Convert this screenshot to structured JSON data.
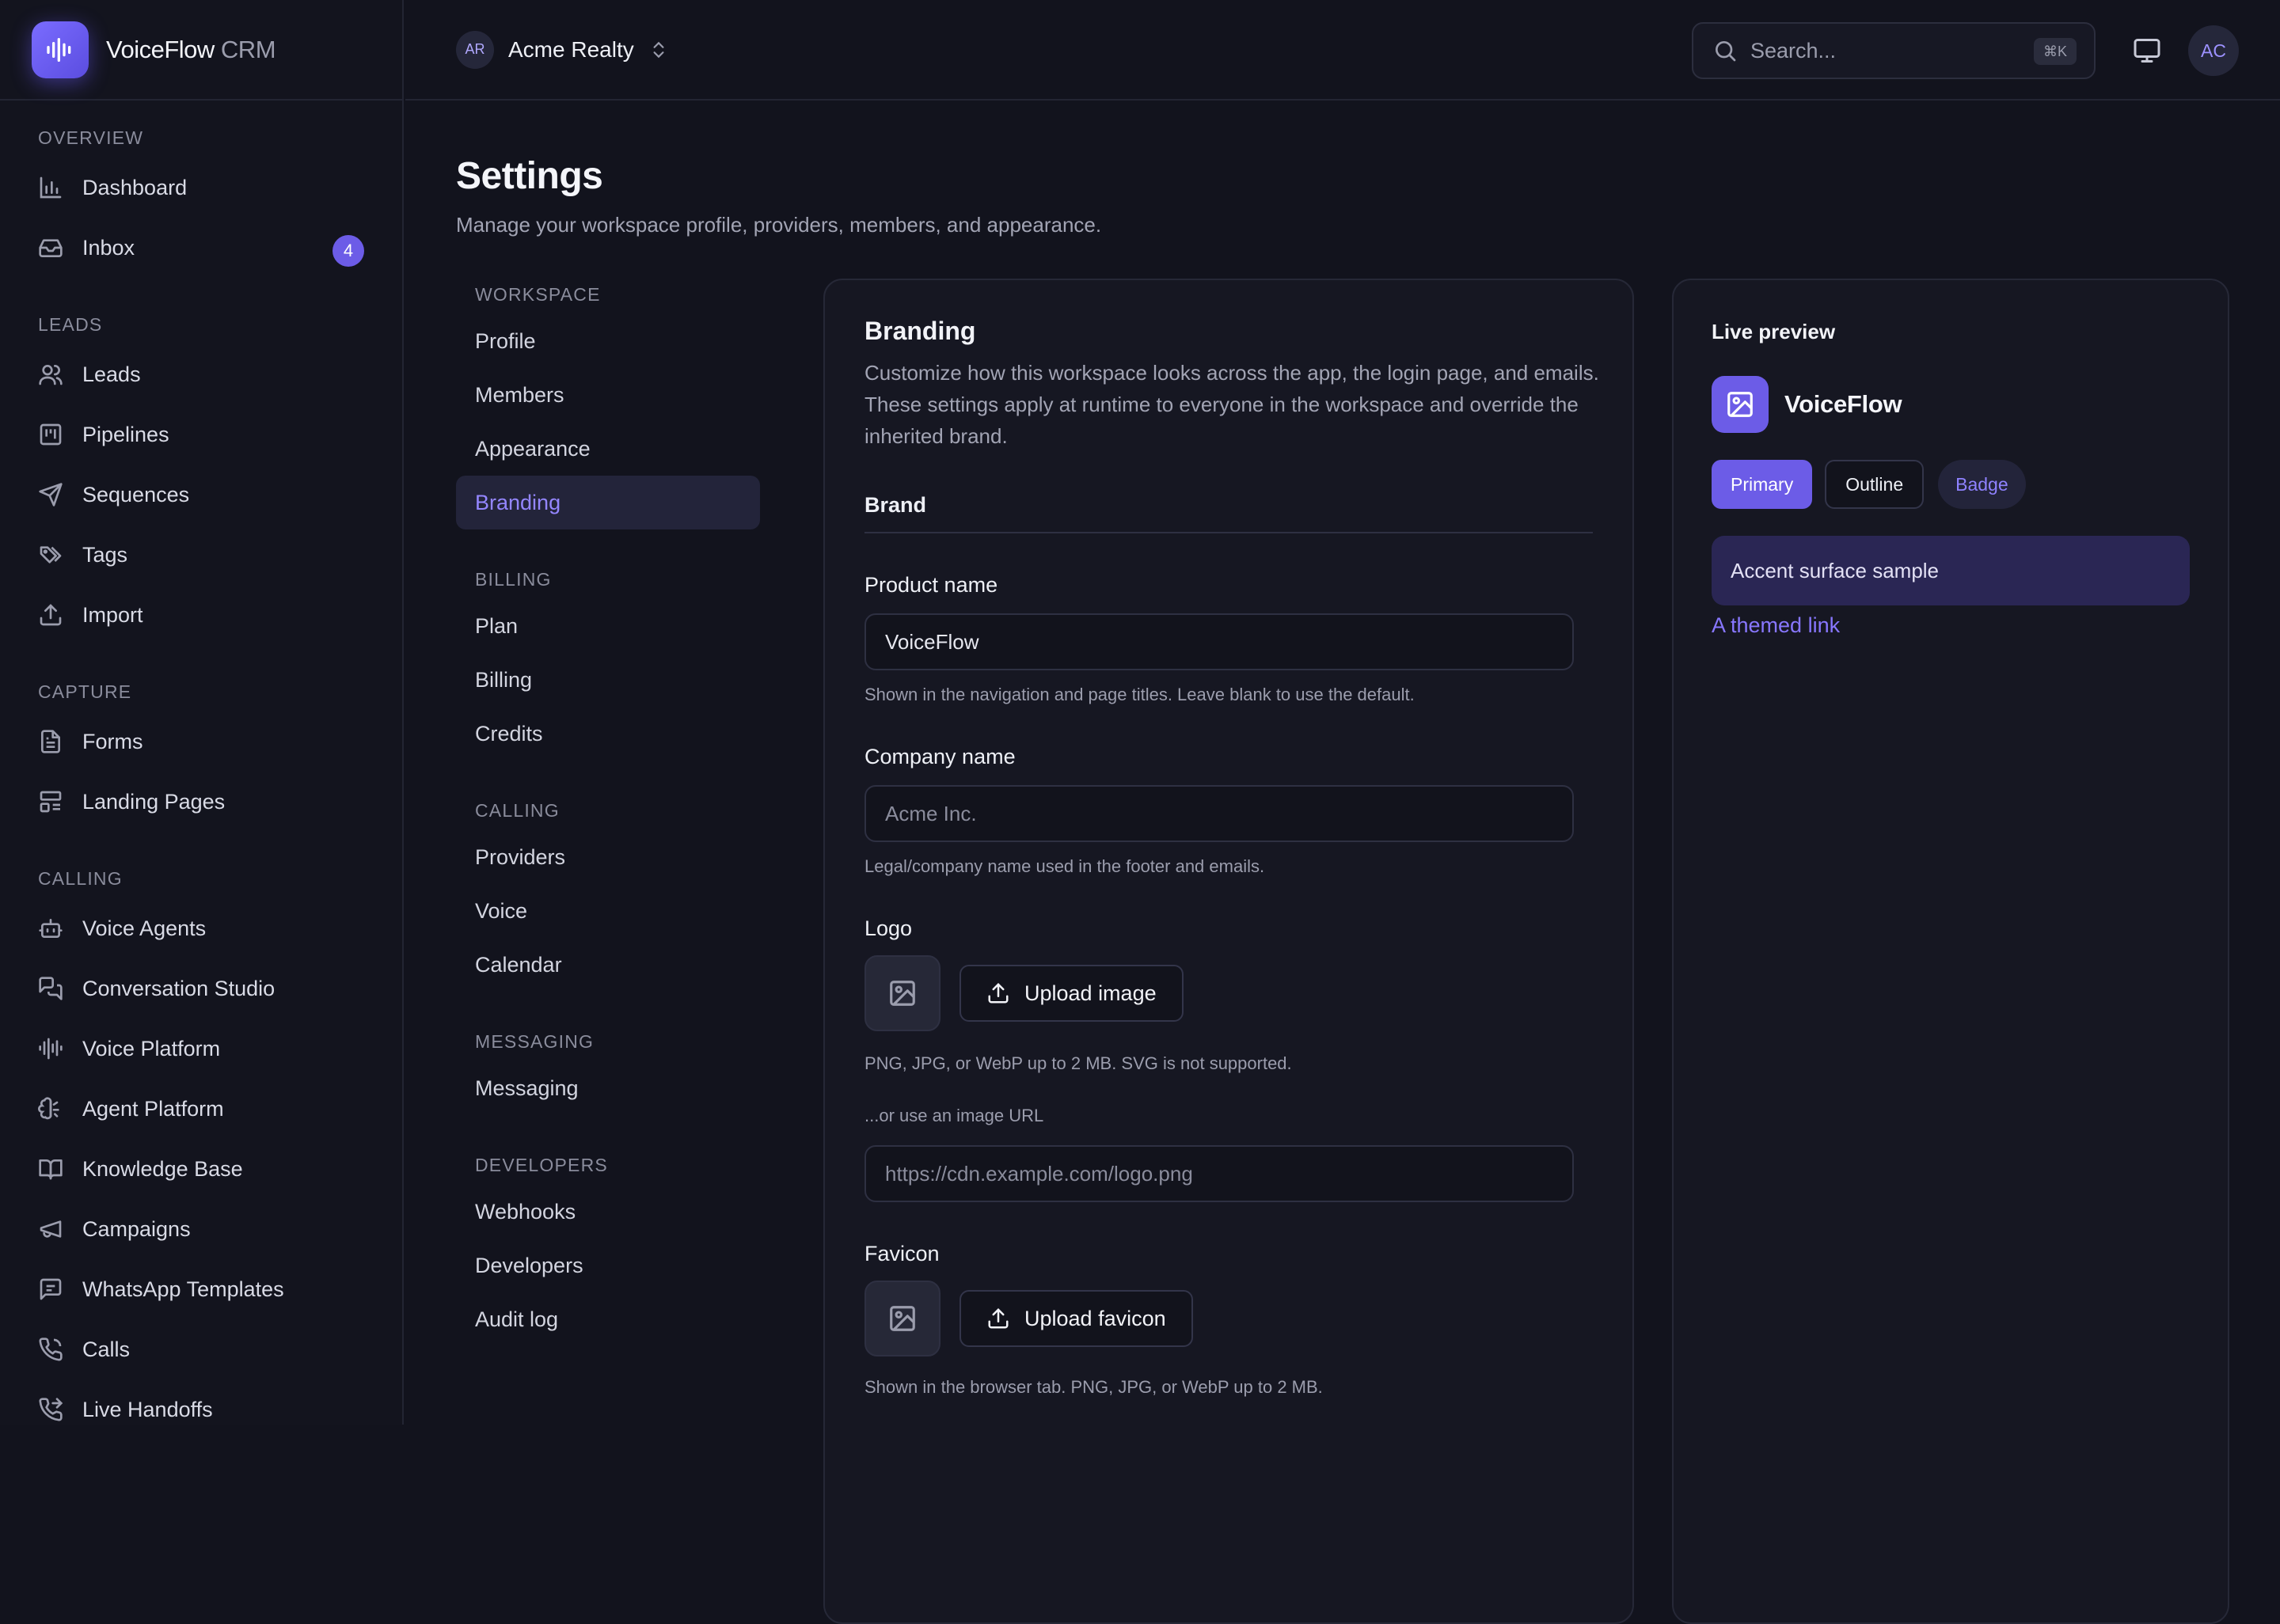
{
  "app": {
    "name": "VoiceFlow",
    "name_suffix": "CRM"
  },
  "sidebar": {
    "sections": [
      {
        "heading": "OVERVIEW",
        "items": [
          {
            "label": "Dashboard",
            "icon": "bar-chart-icon"
          },
          {
            "label": "Inbox",
            "icon": "inbox-icon",
            "badge": "4"
          }
        ]
      },
      {
        "heading": "LEADS",
        "items": [
          {
            "label": "Leads",
            "icon": "users-icon"
          },
          {
            "label": "Pipelines",
            "icon": "kanban-icon"
          },
          {
            "label": "Sequences",
            "icon": "send-icon"
          },
          {
            "label": "Tags",
            "icon": "tags-icon"
          },
          {
            "label": "Import",
            "icon": "upload-icon"
          }
        ]
      },
      {
        "heading": "CAPTURE",
        "items": [
          {
            "label": "Forms",
            "icon": "file-text-icon"
          },
          {
            "label": "Landing Pages",
            "icon": "layout-icon"
          }
        ]
      },
      {
        "heading": "CALLING",
        "items": [
          {
            "label": "Voice Agents",
            "icon": "bot-icon"
          },
          {
            "label": "Conversation Studio",
            "icon": "messages-icon"
          },
          {
            "label": "Voice Platform",
            "icon": "audio-lines-icon"
          },
          {
            "label": "Agent Platform",
            "icon": "brain-icon"
          },
          {
            "label": "Knowledge Base",
            "icon": "book-open-icon"
          },
          {
            "label": "Campaigns",
            "icon": "megaphone-icon"
          },
          {
            "label": "WhatsApp Templates",
            "icon": "message-square-icon"
          },
          {
            "label": "Calls",
            "icon": "phone-icon"
          },
          {
            "label": "Live Handoffs",
            "icon": "phone-forward-icon"
          }
        ]
      }
    ]
  },
  "topbar": {
    "workspace_initials": "AR",
    "workspace_name": "Acme Realty",
    "search_placeholder": "Search...",
    "search_shortcut": "⌘K",
    "user_initials": "AC"
  },
  "page": {
    "title": "Settings",
    "subtitle": "Manage your workspace profile, providers, members, and appearance."
  },
  "settings_nav": [
    {
      "heading": "WORKSPACE",
      "items": [
        "Profile",
        "Members",
        "Appearance",
        "Branding"
      ]
    },
    {
      "heading": "BILLING",
      "items": [
        "Plan",
        "Billing",
        "Credits"
      ]
    },
    {
      "heading": "CALLING",
      "items": [
        "Providers",
        "Voice",
        "Calendar"
      ]
    },
    {
      "heading": "MESSAGING",
      "items": [
        "Messaging"
      ]
    },
    {
      "heading": "DEVELOPERS",
      "items": [
        "Webhooks",
        "Developers",
        "Audit log"
      ]
    }
  ],
  "settings_nav_active": "Branding",
  "branding": {
    "title": "Branding",
    "description": "Customize how this workspace looks across the app, the login page, and emails. These settings apply at runtime to everyone in the workspace and override the inherited brand.",
    "section": "Brand",
    "product_name": {
      "label": "Product name",
      "value": "VoiceFlow",
      "help": "Shown in the navigation and page titles. Leave blank to use the default."
    },
    "company_name": {
      "label": "Company name",
      "placeholder": "Acme Inc.",
      "help": "Legal/company name used in the footer and emails."
    },
    "logo": {
      "label": "Logo",
      "button": "Upload image",
      "help": "PNG, JPG, or WebP up to 2 MB. SVG is not supported.",
      "url_label": "...or use an image URL",
      "url_placeholder": "https://cdn.example.com/logo.png"
    },
    "favicon": {
      "label": "Favicon",
      "button": "Upload favicon",
      "help": "Shown in the browser tab. PNG, JPG, or WebP up to 2 MB."
    }
  },
  "preview": {
    "title": "Live preview",
    "brand_name": "VoiceFlow",
    "primary_label": "Primary",
    "outline_label": "Outline",
    "badge_label": "Badge",
    "surface_text": "Accent surface sample",
    "link_text": "A themed link"
  },
  "colors": {
    "accent": "#6c5ce7",
    "background": "#12131d",
    "surface": "#161722"
  }
}
